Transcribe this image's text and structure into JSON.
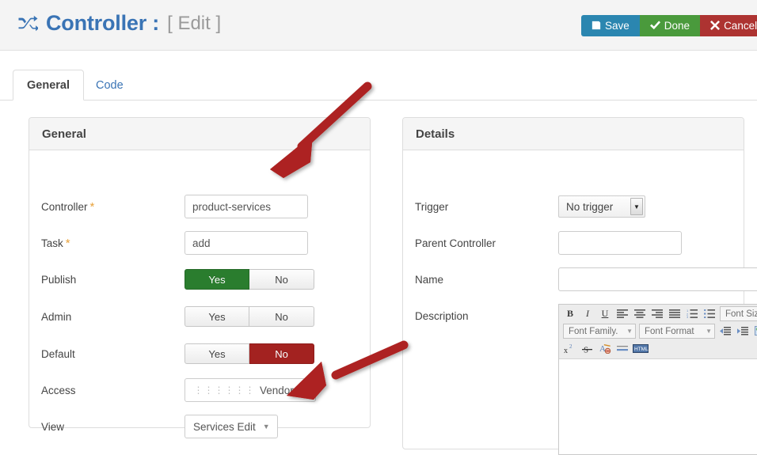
{
  "header": {
    "icon": "shuffle-icon",
    "title": "Controller :",
    "subtitle": "[ Edit ]",
    "buttons": [
      {
        "name": "save",
        "label": "Save",
        "icon": "floppy-disk-icon",
        "glyph": "💾",
        "color": "#2b86b0"
      },
      {
        "name": "done",
        "label": "Done",
        "icon": "check-icon",
        "glyph": "✔",
        "color": "#4a9a3c"
      },
      {
        "name": "cancel",
        "label": "Cancel",
        "icon": "close-x-icon",
        "glyph": "✖",
        "color": "#ad3331"
      }
    ]
  },
  "tabs": [
    {
      "label": "General",
      "active": true
    },
    {
      "label": "Code",
      "active": false
    }
  ],
  "general_panel": {
    "title": "General",
    "fields": {
      "controller": {
        "label": "Controller",
        "required_mark": "*",
        "value": "product-services"
      },
      "task": {
        "label": "Task",
        "required_mark": "*",
        "value": "add"
      },
      "publish": {
        "label": "Publish",
        "yes": "Yes",
        "no": "No",
        "selected": "Yes"
      },
      "admin": {
        "label": "Admin",
        "yes": "Yes",
        "no": "No",
        "selected": ""
      },
      "default": {
        "label": "Default",
        "yes": "Yes",
        "no": "No",
        "selected": "No"
      },
      "access": {
        "label": "Access",
        "value": "Vendor",
        "indent_levels": 6,
        "caret": "▼"
      },
      "view": {
        "label": "View",
        "value": "Services Edit",
        "caret": "▼"
      }
    }
  },
  "details_panel": {
    "title": "Details",
    "fields": {
      "trigger": {
        "label": "Trigger",
        "value": "No trigger",
        "caret": "▼"
      },
      "parent_controller": {
        "label": "Parent Controller",
        "value": ""
      },
      "name": {
        "label": "Name",
        "value": ""
      },
      "description": {
        "label": "Description",
        "value": ""
      }
    },
    "editor": {
      "row1": [
        {
          "name": "bold-icon",
          "glyph": "B"
        },
        {
          "name": "italic-icon",
          "glyph": "I"
        },
        {
          "name": "underline-icon",
          "glyph": "U"
        },
        {
          "name": "align-left-icon",
          "glyph": ""
        },
        {
          "name": "align-center-icon",
          "glyph": ""
        },
        {
          "name": "align-right-icon",
          "glyph": ""
        },
        {
          "name": "align-justify-icon",
          "glyph": ""
        },
        {
          "name": "numbered-list-icon",
          "glyph": ""
        },
        {
          "name": "bullet-list-icon",
          "glyph": ""
        }
      ],
      "font_size_label": "Font Size...",
      "font_family_label": "Font Family.",
      "font_format_label": "Font Format",
      "row2": [
        {
          "name": "outdent-icon"
        },
        {
          "name": "indent-icon"
        },
        {
          "name": "edit-note-icon"
        }
      ],
      "row3": [
        {
          "name": "superscript-icon",
          "glyph": "x²"
        },
        {
          "name": "strikethrough-icon",
          "glyph": "S"
        },
        {
          "name": "remove-format-icon",
          "glyph": "A"
        },
        {
          "name": "horizontal-rule-icon",
          "glyph": ""
        },
        {
          "name": "html-source-icon",
          "glyph": "HTML"
        }
      ]
    }
  },
  "annotations": {
    "arrow_color": "#ad2320",
    "arrows": [
      {
        "name": "arrow-to-controller-field",
        "target": "controller-input"
      },
      {
        "name": "arrow-to-view-dropdown",
        "target": "view-dropdown"
      }
    ]
  }
}
